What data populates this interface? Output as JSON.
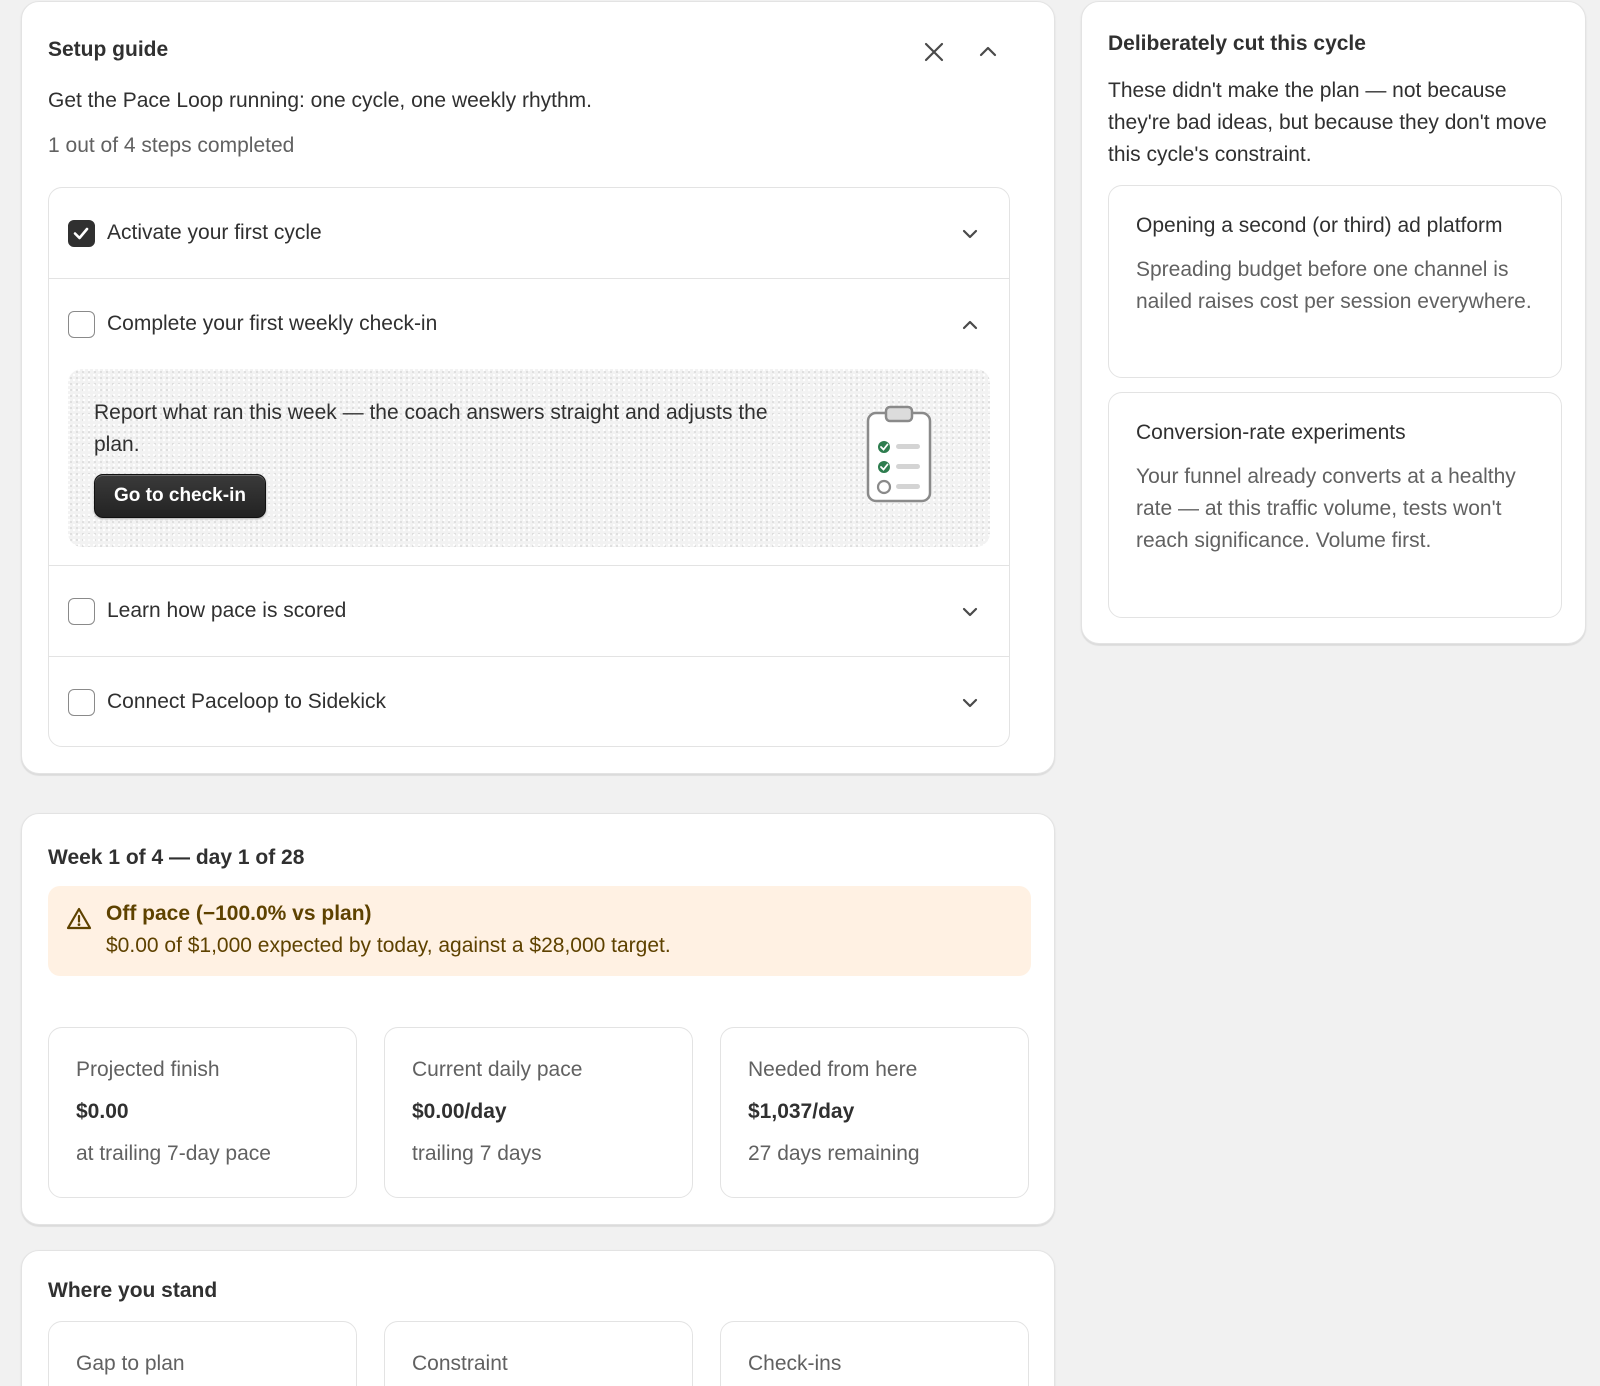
{
  "setup_guide": {
    "title": "Setup guide",
    "description": "Get the Pace Loop running: one cycle, one weekly rhythm.",
    "progress": "1 out of 4 steps completed",
    "steps": [
      {
        "label": "Activate your first cycle",
        "completed": true,
        "expanded": false
      },
      {
        "label": "Complete your first weekly check-in",
        "completed": false,
        "expanded": true,
        "detail": "Report what ran this week — the coach answers straight and adjusts the plan.",
        "button_label": "Go to check-in"
      },
      {
        "label": "Learn how pace is scored",
        "completed": false,
        "expanded": false
      },
      {
        "label": "Connect Paceloop to Sidekick",
        "completed": false,
        "expanded": false
      }
    ]
  },
  "week": {
    "title": "Week 1 of 4 — day 1 of 28",
    "banner": {
      "title": "Off pace (−100.0% vs plan)",
      "text": "$0.00 of $1,000 expected by today, against a $28,000 target."
    },
    "stats": [
      {
        "label": "Projected finish",
        "value": "$0.00",
        "sub": "at trailing 7-day pace"
      },
      {
        "label": "Current daily pace",
        "value": "$0.00/day",
        "sub": "trailing 7 days"
      },
      {
        "label": "Needed from here",
        "value": "$1,037/day",
        "sub": "27 days remaining"
      }
    ]
  },
  "where_you_stand": {
    "title": "Where you stand",
    "items": [
      {
        "label": "Gap to plan"
      },
      {
        "label": "Constraint"
      },
      {
        "label": "Check-ins"
      }
    ]
  },
  "deliberately_cut": {
    "title": "Deliberately cut this cycle",
    "intro": "These didn't make the plan — not because they're bad ideas, but because they don't move this cycle's constraint.",
    "items": [
      {
        "title": "Opening a second (or third) ad platform",
        "body": "Spreading budget before one channel is nailed raises cost per session everywhere."
      },
      {
        "title": "Conversion-rate experiments",
        "body": "Your funnel already converts at a healthy rate — at this traffic volume, tests won't reach significance. Volume first."
      }
    ]
  },
  "colors": {
    "page_bg": "#f1f1f1",
    "card_bg": "#ffffff",
    "banner_bg": "#fff1e3",
    "banner_text": "#5e4200",
    "button_bg": "#303030",
    "check_green": "#2e7d4f"
  },
  "icons": {
    "dismiss": "close-icon",
    "collapse": "chevron-up-icon",
    "step_collapsed": "chevron-down-icon",
    "step_expanded": "chevron-up-icon",
    "checkbox_checked": "checkmark-icon",
    "illustration": "clipboard-checklist-icon",
    "banner": "warning-triangle-icon"
  }
}
